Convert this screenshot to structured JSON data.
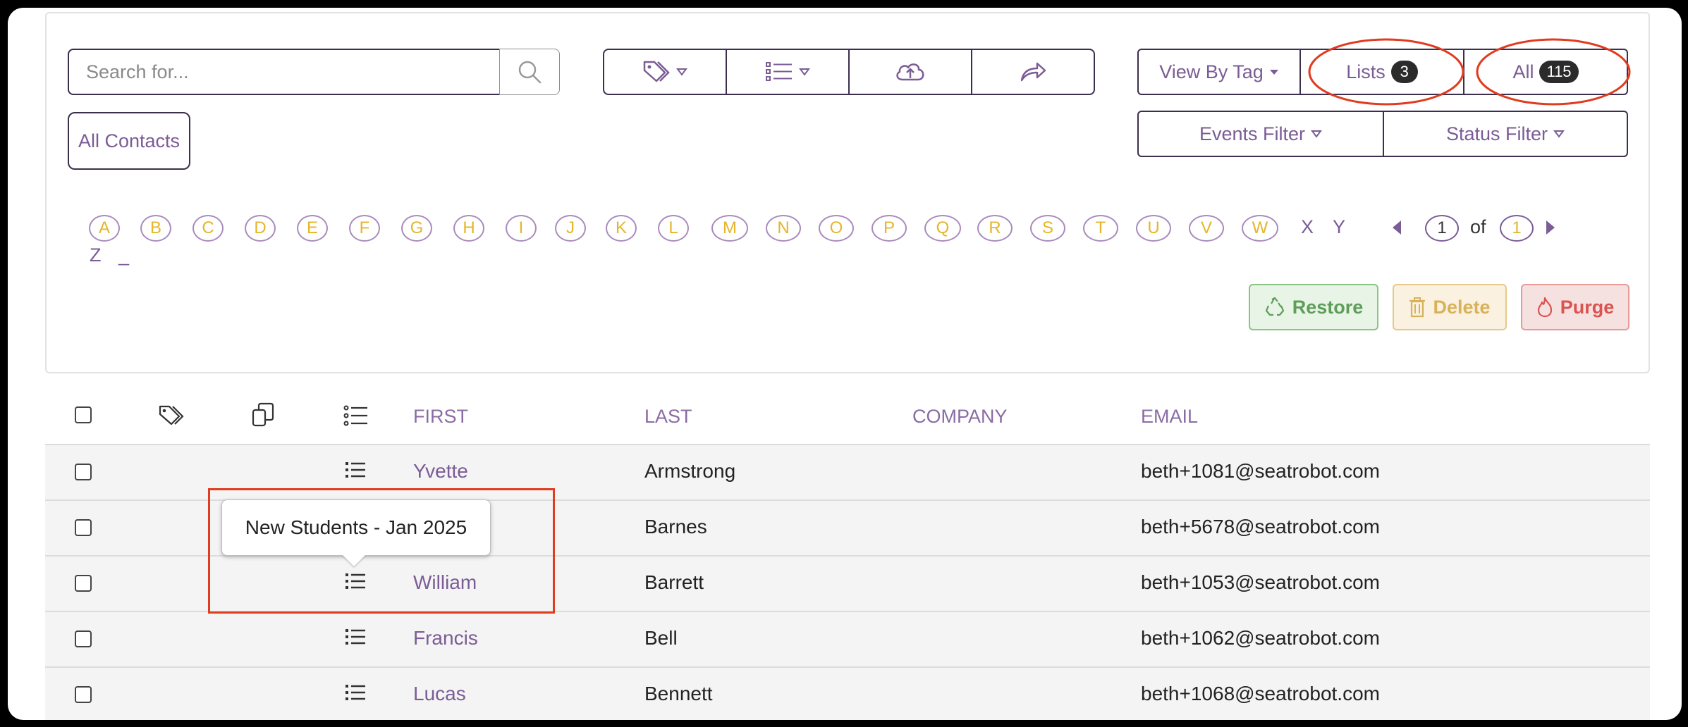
{
  "search": {
    "placeholder": "Search for..."
  },
  "toolbar": {
    "tag_icon": "tag-icon",
    "list_icon": "list-icon",
    "upload_icon": "cloud-upload-icon",
    "share_icon": "share-icon"
  },
  "views": {
    "view_by_tag": "View By Tag",
    "lists_label": "Lists",
    "lists_count": "3",
    "all_label": "All",
    "all_count": "115",
    "events_filter": "Events Filter",
    "status_filter": "Status Filter"
  },
  "all_contacts": "All Contacts",
  "alphabet": {
    "circled": [
      "A",
      "B",
      "C",
      "D",
      "E",
      "F",
      "G",
      "H",
      "I",
      "J",
      "K",
      "L",
      "M",
      "N",
      "O",
      "P",
      "Q",
      "R",
      "S",
      "T",
      "U",
      "V",
      "W"
    ],
    "plain": [
      "X",
      "Y",
      "Z",
      "_"
    ]
  },
  "pagination": {
    "current": "1",
    "of": "of",
    "total": "1"
  },
  "actions": {
    "restore": "Restore",
    "delete": "Delete",
    "purge": "Purge"
  },
  "colors": {
    "accent": "#7b5c95",
    "restore": "#5e9e5a",
    "delete": "#d8b25a",
    "purge": "#d9534f",
    "annotation": "#e03c1f"
  },
  "table": {
    "headers": {
      "first": "FIRST",
      "last": "LAST",
      "company": "COMPANY",
      "email": "EMAIL"
    },
    "rows": [
      {
        "first": "Yvette",
        "last": "Armstrong",
        "company": "",
        "email": "beth+1081@seatrobot.com"
      },
      {
        "first": "",
        "last": "Barnes",
        "company": "",
        "email": "beth+5678@seatrobot.com"
      },
      {
        "first": "William",
        "last": "Barrett",
        "company": "",
        "email": "beth+1053@seatrobot.com"
      },
      {
        "first": "Francis",
        "last": "Bell",
        "company": "",
        "email": "beth+1062@seatrobot.com"
      },
      {
        "first": "Lucas",
        "last": "Bennett",
        "company": "",
        "email": "beth+1068@seatrobot.com"
      }
    ]
  },
  "tooltip": {
    "text": "New Students - Jan 2025"
  }
}
